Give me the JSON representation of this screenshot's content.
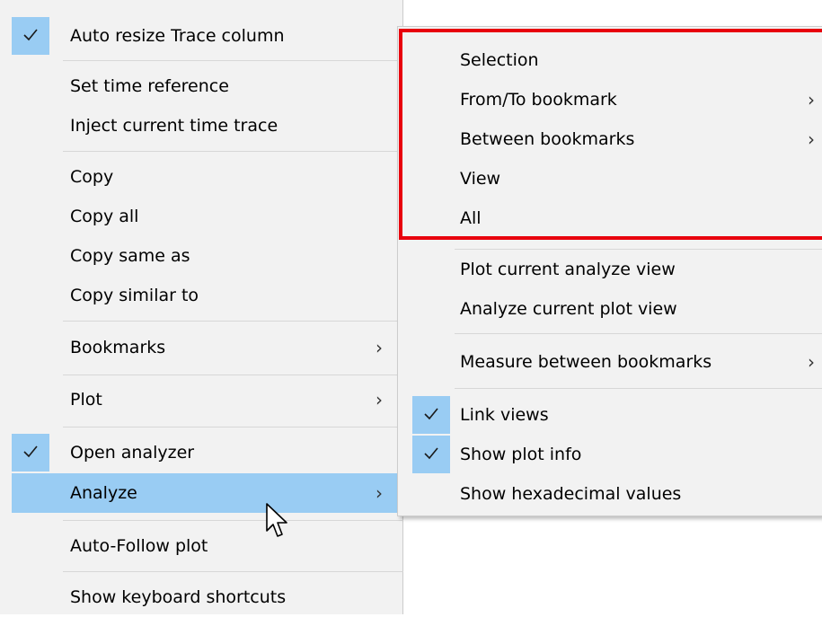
{
  "main_menu": {
    "items": [
      {
        "label": "Auto resize Trace column",
        "checked": true
      },
      {
        "label": "Set time reference"
      },
      {
        "label": "Inject current time trace"
      },
      {
        "label": "Copy"
      },
      {
        "label": "Copy all"
      },
      {
        "label": "Copy same as"
      },
      {
        "label": "Copy similar to"
      },
      {
        "label": "Bookmarks",
        "submenu": true
      },
      {
        "label": "Plot",
        "submenu": true
      },
      {
        "label": "Open analyzer",
        "checked": true
      },
      {
        "label": "Analyze",
        "submenu": true,
        "highlighted": true
      },
      {
        "label": "Auto-Follow plot"
      },
      {
        "label": "Show keyboard shortcuts"
      }
    ]
  },
  "sub_menu": {
    "items": [
      {
        "label": "Selection"
      },
      {
        "label": "From/To bookmark",
        "submenu": true
      },
      {
        "label": "Between bookmarks",
        "submenu": true
      },
      {
        "label": "View"
      },
      {
        "label": "All"
      },
      {
        "label": "Plot current analyze view"
      },
      {
        "label": "Analyze current plot view"
      },
      {
        "label": "Measure between bookmarks",
        "submenu": true
      },
      {
        "label": "Link views",
        "checked": true
      },
      {
        "label": "Show plot info",
        "checked": true
      },
      {
        "label": "Show hexadecimal values"
      }
    ]
  },
  "glyphs": {
    "chevron": "›"
  },
  "colors": {
    "menu_bg": "#f2f2f2",
    "hover_bg": "#99ccf3",
    "annotation_border": "#e8000d"
  }
}
